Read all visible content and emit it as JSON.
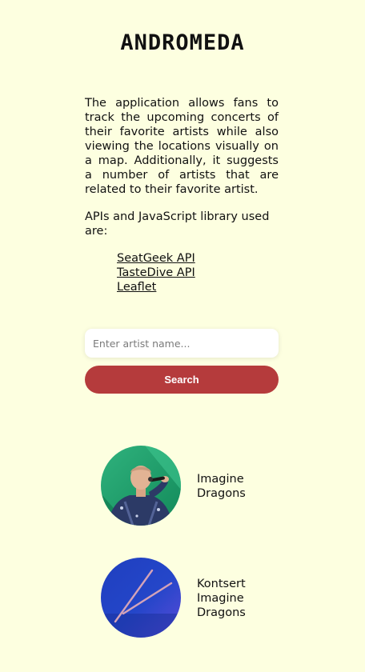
{
  "header": {
    "brand": "ANDROMEDA"
  },
  "intro": {
    "description": "The application allows fans to track the upcoming concerts of their favorite artists while also viewing the locations visually on a map. Additionally, it suggests a number of artists that are related to their favorite artist.",
    "apis_heading": "APIs and JavaScript library used are:",
    "apis": [
      {
        "label": "SeatGeek API"
      },
      {
        "label": "TasteDive API"
      },
      {
        "label": "Leaflet"
      }
    ]
  },
  "search": {
    "placeholder": "Enter artist name...",
    "button_label": "Search",
    "button_color": "#b53b3c"
  },
  "results": [
    {
      "name": "Imagine Dragons",
      "image": "singer-performing-photo"
    },
    {
      "name": "Kontsert Imagine Dragons",
      "image": "drumsticks-blue-photo"
    }
  ]
}
